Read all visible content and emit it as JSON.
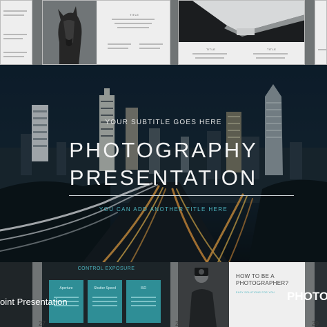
{
  "thumbs_top": {
    "title_label": "TITLE",
    "body_text": "Lorem ipsum is simply dummy text of the printing and typesetting industry."
  },
  "main_slide": {
    "subtitle": "YOUR SUBTITLE GOES HERE",
    "title_line1": "PHOTOGRAPHY",
    "title_line2": "PRESENTATION",
    "tagline": "YOU CAN ADD ANOTHER TITLE HERE"
  },
  "bottom": {
    "control_title": "CONTROL EXPOSURE",
    "cards": [
      {
        "label": "Aperture"
      },
      {
        "label": "Shutter Speed"
      },
      {
        "label": "ISO"
      }
    ],
    "howto_line1": "HOW TO BE A",
    "howto_line2": "PHOTOGRAPHER?",
    "howto_sub": "EASY SOLUTIONS FOR YOU",
    "page_numbers": [
      "27",
      "28",
      "29"
    ]
  },
  "overlay": {
    "left_text": "oint Presentation",
    "right_text": "PHOTO"
  },
  "colors": {
    "accent": "#4cb5c0",
    "card": "#2f8e96",
    "thumb_bg": "#eeeeee"
  }
}
